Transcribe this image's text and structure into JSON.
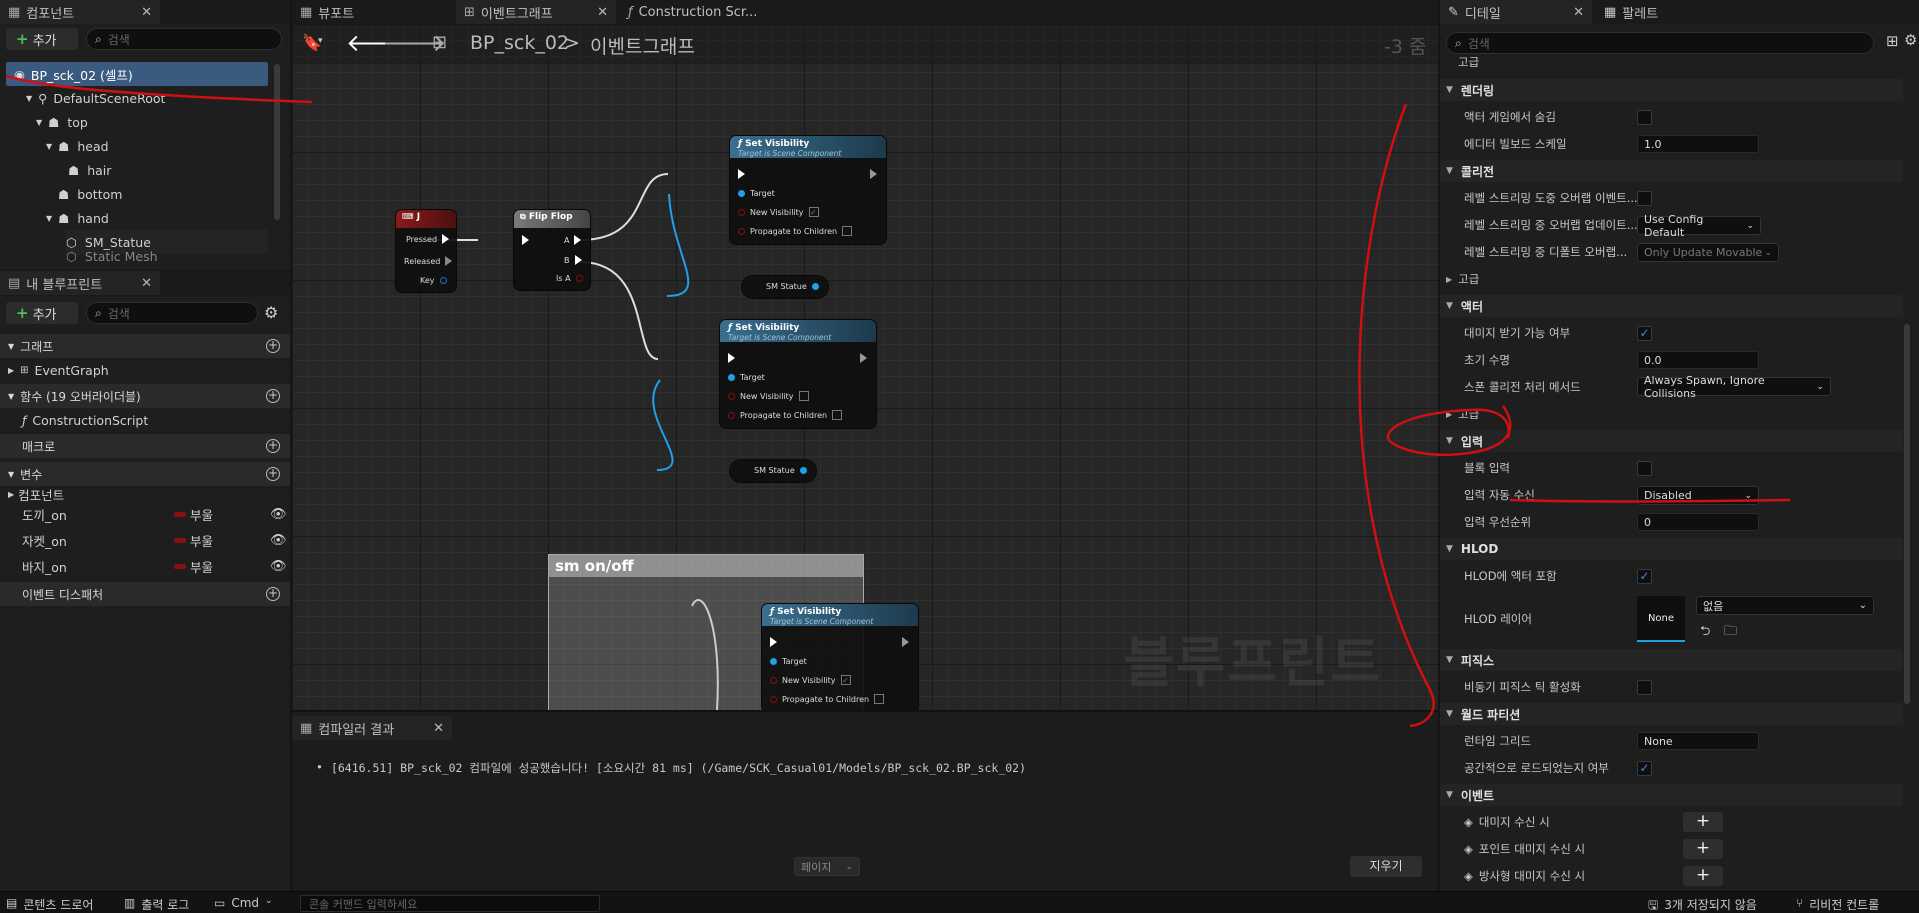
{
  "components_panel": {
    "tab_label": "컴포넌트",
    "add_label": "추가",
    "search_placeholder": "검색",
    "tree": [
      {
        "label": "BP_sck_02 (셀프)"
      },
      {
        "label": "DefaultSceneRoot"
      },
      {
        "label": "top"
      },
      {
        "label": "head"
      },
      {
        "label": "hair"
      },
      {
        "label": "bottom"
      },
      {
        "label": "hand"
      },
      {
        "label": "SM_Statue"
      },
      {
        "label": "Static Mesh"
      }
    ]
  },
  "my_blueprint": {
    "tab_label": "내 블루프린트",
    "add_label": "추가",
    "search_placeholder": "검색",
    "sections": {
      "graph": "그래프",
      "event_graph": "EventGraph",
      "functions": "함수 (19 오버라이더블)",
      "construction_script": "ConstructionScript",
      "macros": "매크로",
      "variables": "변수",
      "components": "컴포넌트",
      "event_dispatchers": "이벤트 디스패처"
    },
    "variables": [
      {
        "name": "도끼_on",
        "type": "부울"
      },
      {
        "name": "자켓_on",
        "type": "부울"
      },
      {
        "name": "바지_on",
        "type": "부울"
      }
    ]
  },
  "center_tabs": [
    {
      "label": "뷰포트"
    },
    {
      "label": "이벤트그래프"
    },
    {
      "label": "Construction Scr..."
    }
  ],
  "breadcrumb": {
    "blueprint": "BP_sck_02",
    "separator": ">",
    "graph": "이벤트그래프",
    "zoom": "-3 줌"
  },
  "graph": {
    "watermark": "블루프린트",
    "comment_title": "sm on/off",
    "key_node": {
      "title": "J",
      "pins": [
        "Pressed",
        "Released",
        "Key"
      ]
    },
    "flipflop": {
      "title": "Flip Flop",
      "pins": [
        "A",
        "B",
        "Is A"
      ]
    },
    "set_visibility": {
      "title": "Set Visibility",
      "subtitle": "Target is Scene Component",
      "pins": [
        "Target",
        "New Visibility",
        "Propagate to Children"
      ]
    },
    "statue_ref": "SM Statue"
  },
  "compiler": {
    "tab_label": "컴파일러 결과",
    "message": "[6416.51] BP_sck_02 컴파일에 성공했습니다! [소요시간 81 ms] (/Game/SCK_Casual01/Models/BP_sck_02.BP_sck_02)",
    "page_label": "페이지",
    "clear_label": "지우기"
  },
  "details": {
    "tab_label": "디테일",
    "palette_label": "팔레트",
    "search_placeholder": "검색",
    "top_partial": "고급",
    "sections": {
      "rendering": "렌더링",
      "collision": "콜리전",
      "advanced": "고급",
      "actor": "액터",
      "advanced2": "고급",
      "input": "입력",
      "hlod": "HLOD",
      "physics": "피직스",
      "world_partition": "월드 파티션",
      "events": "이벤트"
    },
    "rows": {
      "hide_in_game": "액터 게임에서 숨김",
      "editor_billboard": "에디터 빌보드 스케일",
      "editor_billboard_value": "1.0",
      "overlap_streaming": "레벨 스트리밍 도중 오버랩 이벤트...",
      "overlap_update": "레벨 스트리밍 중 오버랩 업데이트...",
      "overlap_update_value": "Use Config Default",
      "default_overlap": "레벨 스트리밍 중 디폴트 오버랩...",
      "default_overlap_value": "Only Update Movable",
      "can_be_damaged": "대미지 받기 가능 여부",
      "initial_life": "초기 수명",
      "initial_life_value": "0.0",
      "spawn_collision": "스폰 콜리전 처리 메서드",
      "spawn_collision_value": "Always Spawn, Ignore Collisions",
      "block_input": "블록 입력",
      "auto_receive_input": "입력 자동 수신",
      "auto_receive_input_value": "Disabled",
      "input_priority": "입력 우선순위",
      "input_priority_value": "0",
      "include_in_hlod": "HLOD에 액터 포함",
      "hlod_layer": "HLOD 레이어",
      "hlod_layer_value": "없음",
      "hlod_thumb": "None",
      "async_physics": "비동기 피직스 틱 활성화",
      "runtime_grid": "런타임 그리드",
      "runtime_grid_value": "None",
      "spatially_loaded": "공간적으로 로드되었는지 여부",
      "on_damage": "대미지 수신 시",
      "on_point_damage": "포인트 대미지 수신 시",
      "on_radial_damage": "방사형 대미지 수신 시"
    }
  },
  "bottom_bar": {
    "content_drawer": "콘텐츠 드로어",
    "output_log": "출력 로그",
    "cmd": "Cmd",
    "console_placeholder": "콘솔 커맨드 입력하세요",
    "unsaved": "3개 저장되지 않음",
    "source_control": "리비전 컨트롤"
  },
  "colors": {
    "accent": "#1fa0e8",
    "annotation": "#d01010",
    "key_header": "#8b1a1a"
  }
}
